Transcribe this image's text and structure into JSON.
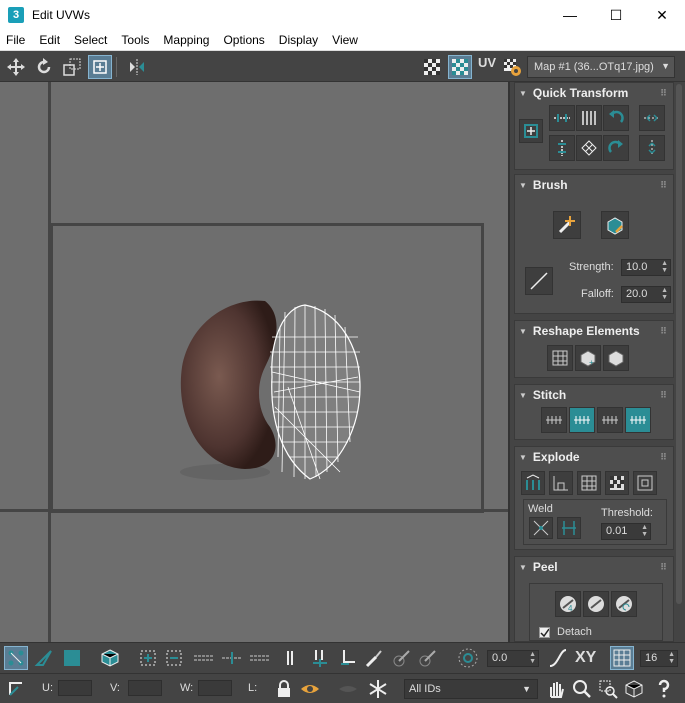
{
  "window": {
    "title": "Edit UVWs",
    "app_icon_text": "3",
    "minimize": "—",
    "maximize": "☐",
    "close": "✕"
  },
  "menu": [
    "File",
    "Edit",
    "Select",
    "Tools",
    "Mapping",
    "Options",
    "Display",
    "View"
  ],
  "toolbar_top": {
    "uv_label": "UV",
    "map_select": "Map #1 (36...OTq17.jpg)"
  },
  "panel": {
    "quick_transform": {
      "title": "Quick Transform"
    },
    "brush": {
      "title": "Brush",
      "strength_label": "Strength:",
      "strength_value": "10.0",
      "falloff_label": "Falloff:",
      "falloff_value": "20.0"
    },
    "reshape": {
      "title": "Reshape Elements"
    },
    "stitch": {
      "title": "Stitch"
    },
    "explode": {
      "title": "Explode",
      "weld_label": "Weld",
      "threshold_label": "Threshold:",
      "threshold_value": "0.01"
    },
    "peel": {
      "title": "Peel",
      "detach_label": "Detach"
    }
  },
  "bottom1": {
    "spin_value": "0.0",
    "xy_label": "XY",
    "count_value": "16"
  },
  "bottom2": {
    "u_label": "U:",
    "v_label": "V:",
    "w_label": "W:",
    "l_label": "L:",
    "ids_select": "All IDs"
  },
  "colors": {
    "accent": "#2b8d95",
    "viewport_bg": "#6e6e6e",
    "panel_bg": "#444444"
  }
}
